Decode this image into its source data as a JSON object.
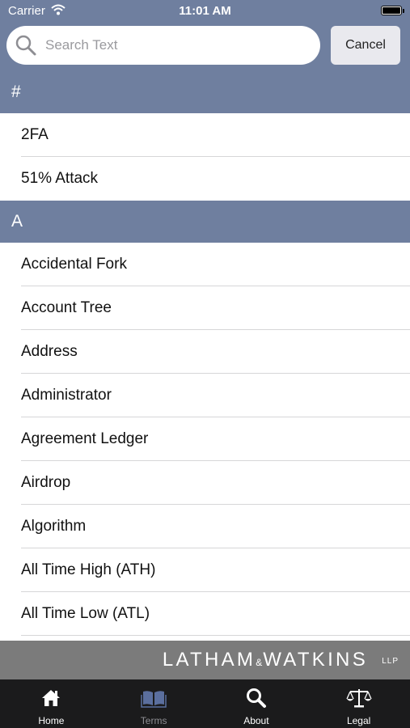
{
  "status_bar": {
    "carrier": "Carrier",
    "time": "11:01 AM"
  },
  "search": {
    "placeholder": "Search Text",
    "value": "",
    "cancel_label": "Cancel"
  },
  "sections": [
    {
      "header": "#",
      "items": [
        "2FA",
        "51% Attack"
      ]
    },
    {
      "header": "A",
      "items": [
        "Accidental Fork",
        "Account Tree",
        "Address",
        "Administrator",
        "Agreement Ledger",
        "Airdrop",
        "Algorithm",
        "All Time High (ATH)",
        "All Time Low (ATL)"
      ]
    }
  ],
  "brand": {
    "name": "LATHAM&WATKINS",
    "name_main_left": "LATHAM",
    "ampersand": "&",
    "name_main_right": "WATKINS",
    "suffix": "LLP"
  },
  "tabs": [
    {
      "label": "Home",
      "icon": "home-icon",
      "active": true
    },
    {
      "label": "Terms",
      "icon": "book-icon",
      "active": false
    },
    {
      "label": "About",
      "icon": "search-icon",
      "active": true
    },
    {
      "label": "Legal",
      "icon": "scales-icon",
      "active": true
    }
  ],
  "colors": {
    "header_blue": "#6f7f9f",
    "brand_gray": "#7b7b7b",
    "tab_bar": "#1b1b1c"
  }
}
